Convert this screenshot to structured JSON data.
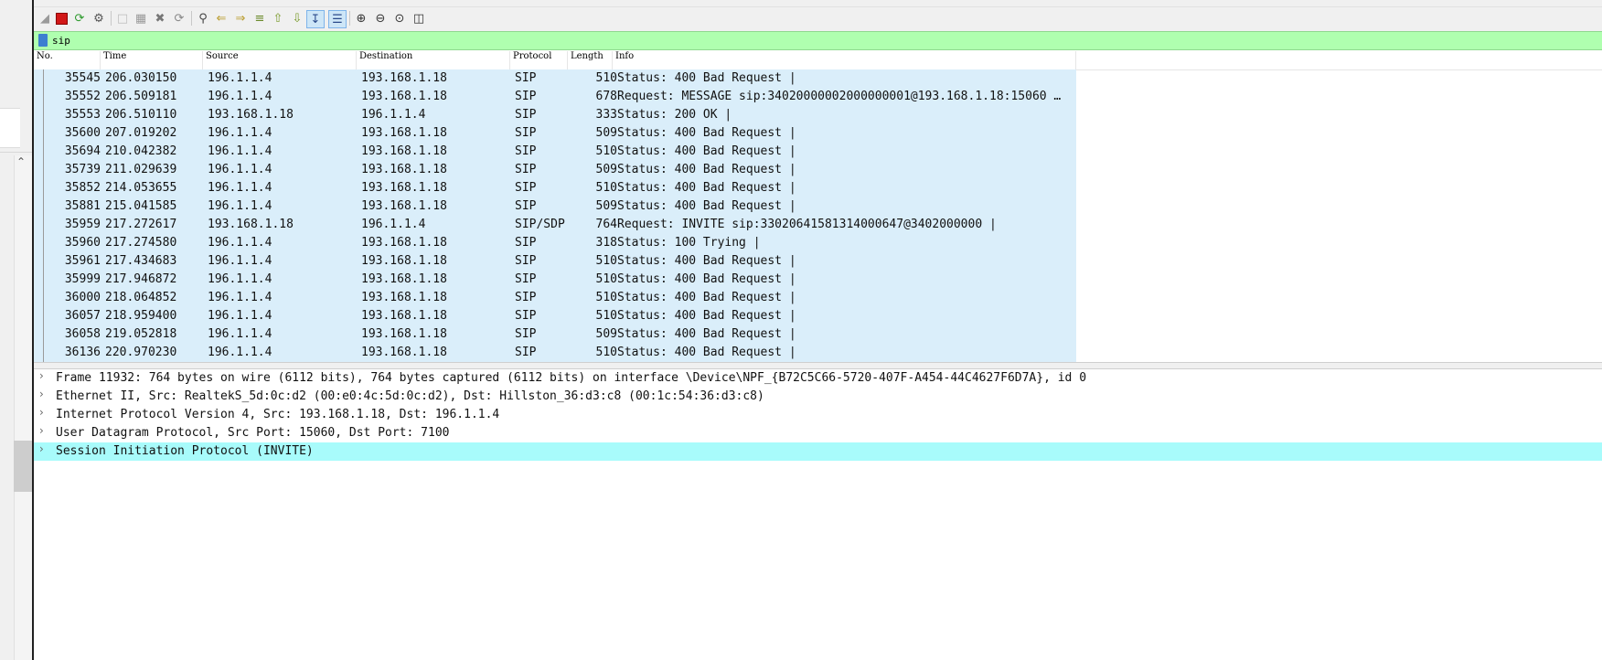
{
  "toolbar": {
    "icons": [
      "shark-fin-icon",
      "stop-icon",
      "restart-icon",
      "options-icon",
      "open-icon",
      "save-icon",
      "close-file-icon",
      "reload-icon",
      "find-icon",
      "back-icon",
      "forward-icon",
      "goto-packet-icon",
      "first-packet-icon",
      "last-packet-icon",
      "autoscroll-icon",
      "colorize-icon",
      "zoom-in-icon",
      "zoom-out-icon",
      "normal-size-icon",
      "resize-columns-icon"
    ]
  },
  "filter": {
    "value": "sip"
  },
  "packet_list": {
    "columns": [
      "No.",
      "Time",
      "Source",
      "Destination",
      "Protocol",
      "Length",
      "Info"
    ],
    "rows": [
      {
        "no": "35545",
        "time": "206.030150",
        "src": "196.1.1.4",
        "dst": "193.168.1.18",
        "proto": "SIP",
        "len": "510",
        "info": "Status: 400 Bad Request |"
      },
      {
        "no": "35552",
        "time": "206.509181",
        "src": "196.1.1.4",
        "dst": "193.168.1.18",
        "proto": "SIP",
        "len": "678",
        "info": "Request: MESSAGE sip:34020000002000000001@193.168.1.18:15060 …"
      },
      {
        "no": "35553",
        "time": "206.510110",
        "src": "193.168.1.18",
        "dst": "196.1.1.4",
        "proto": "SIP",
        "len": "333",
        "info": "Status: 200 OK |"
      },
      {
        "no": "35600",
        "time": "207.019202",
        "src": "196.1.1.4",
        "dst": "193.168.1.18",
        "proto": "SIP",
        "len": "509",
        "info": "Status: 400 Bad Request |"
      },
      {
        "no": "35694",
        "time": "210.042382",
        "src": "196.1.1.4",
        "dst": "193.168.1.18",
        "proto": "SIP",
        "len": "510",
        "info": "Status: 400 Bad Request |"
      },
      {
        "no": "35739",
        "time": "211.029639",
        "src": "196.1.1.4",
        "dst": "193.168.1.18",
        "proto": "SIP",
        "len": "509",
        "info": "Status: 400 Bad Request |"
      },
      {
        "no": "35852",
        "time": "214.053655",
        "src": "196.1.1.4",
        "dst": "193.168.1.18",
        "proto": "SIP",
        "len": "510",
        "info": "Status: 400 Bad Request |"
      },
      {
        "no": "35881",
        "time": "215.041585",
        "src": "196.1.1.4",
        "dst": "193.168.1.18",
        "proto": "SIP",
        "len": "509",
        "info": "Status: 400 Bad Request |"
      },
      {
        "no": "35959",
        "time": "217.272617",
        "src": "193.168.1.18",
        "dst": "196.1.1.4",
        "proto": "SIP/SDP",
        "len": "764",
        "info": "Request: INVITE sip:33020641581314000647@3402000000 |"
      },
      {
        "no": "35960",
        "time": "217.274580",
        "src": "196.1.1.4",
        "dst": "193.168.1.18",
        "proto": "SIP",
        "len": "318",
        "info": "Status: 100 Trying |"
      },
      {
        "no": "35961",
        "time": "217.434683",
        "src": "196.1.1.4",
        "dst": "193.168.1.18",
        "proto": "SIP",
        "len": "510",
        "info": "Status: 400 Bad Request |"
      },
      {
        "no": "35999",
        "time": "217.946872",
        "src": "196.1.1.4",
        "dst": "193.168.1.18",
        "proto": "SIP",
        "len": "510",
        "info": "Status: 400 Bad Request |"
      },
      {
        "no": "36000",
        "time": "218.064852",
        "src": "196.1.1.4",
        "dst": "193.168.1.18",
        "proto": "SIP",
        "len": "510",
        "info": "Status: 400 Bad Request |"
      },
      {
        "no": "36057",
        "time": "218.959400",
        "src": "196.1.1.4",
        "dst": "193.168.1.18",
        "proto": "SIP",
        "len": "510",
        "info": "Status: 400 Bad Request |"
      },
      {
        "no": "36058",
        "time": "219.052818",
        "src": "196.1.1.4",
        "dst": "193.168.1.18",
        "proto": "SIP",
        "len": "509",
        "info": "Status: 400 Bad Request |"
      },
      {
        "no": "36136",
        "time": "220.970230",
        "src": "196.1.1.4",
        "dst": "193.168.1.18",
        "proto": "SIP",
        "len": "510",
        "info": "Status: 400 Bad Request |"
      }
    ]
  },
  "details": {
    "items": [
      {
        "label": "Frame 11932: 764 bytes on wire (6112 bits), 764 bytes captured (6112 bits) on interface \\Device\\NPF_{B72C5C66-5720-407F-A454-44C4627F6D7A}, id 0",
        "selected": false
      },
      {
        "label": "Ethernet II, Src: RealtekS_5d:0c:d2 (00:e0:4c:5d:0c:d2), Dst: Hillston_36:d3:c8 (00:1c:54:36:d3:c8)",
        "selected": false
      },
      {
        "label": "Internet Protocol Version 4, Src: 193.168.1.18, Dst: 196.1.1.4",
        "selected": false
      },
      {
        "label": "User Datagram Protocol, Src Port: 15060, Dst Port: 7100",
        "selected": false
      },
      {
        "label": "Session Initiation Protocol (INVITE)",
        "selected": true
      }
    ]
  },
  "colors": {
    "row_bg": "#daeefa",
    "filter_bg": "#afffaf",
    "selected_detail_bg": "#a8fbfb"
  }
}
